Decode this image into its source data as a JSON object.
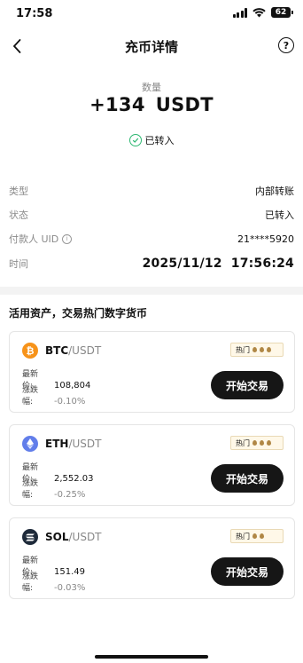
{
  "status_bar": {
    "time": "17:58",
    "battery": "62"
  },
  "nav": {
    "title": "充币详情",
    "help": "?"
  },
  "summary": {
    "label": "数量",
    "amount": "+134",
    "unit": "USDT",
    "status": "已转入"
  },
  "details": [
    {
      "label": "类型",
      "value": "内部转账"
    },
    {
      "label": "状态",
      "value": "已转入"
    },
    {
      "label": "付款人 UID",
      "value": "21****5920"
    },
    {
      "label": "时间",
      "date": "2025/11/12",
      "time": "17:56:24"
    }
  ],
  "section": {
    "title": "活用资产，交易热门数字货币"
  },
  "cards": [
    {
      "coin_icon": "bitcoin-icon",
      "coin_color": "#f7931a",
      "base": "BTC",
      "quote": "/USDT",
      "hot_label": "热门",
      "hot_level": 3,
      "price_label": "最新价:",
      "price": "108,804",
      "change_label": "涨跌幅:",
      "change": "-0.10%",
      "button": "开始交易"
    },
    {
      "coin_icon": "ethereum-icon",
      "coin_color": "#627eea",
      "base": "ETH",
      "quote": "/USDT",
      "hot_label": "热门",
      "hot_level": 3,
      "price_label": "最新价:",
      "price": "2,552.03",
      "change_label": "涨跌幅:",
      "change": "-0.25%",
      "button": "开始交易"
    },
    {
      "coin_icon": "solana-icon",
      "coin_color": "#1e2a3a",
      "base": "SOL",
      "quote": "/USDT",
      "hot_label": "热门",
      "hot_level": 2,
      "price_label": "最新价:",
      "price": "151.49",
      "change_label": "涨跌幅:",
      "change": "-0.03%",
      "button": "开始交易"
    }
  ]
}
